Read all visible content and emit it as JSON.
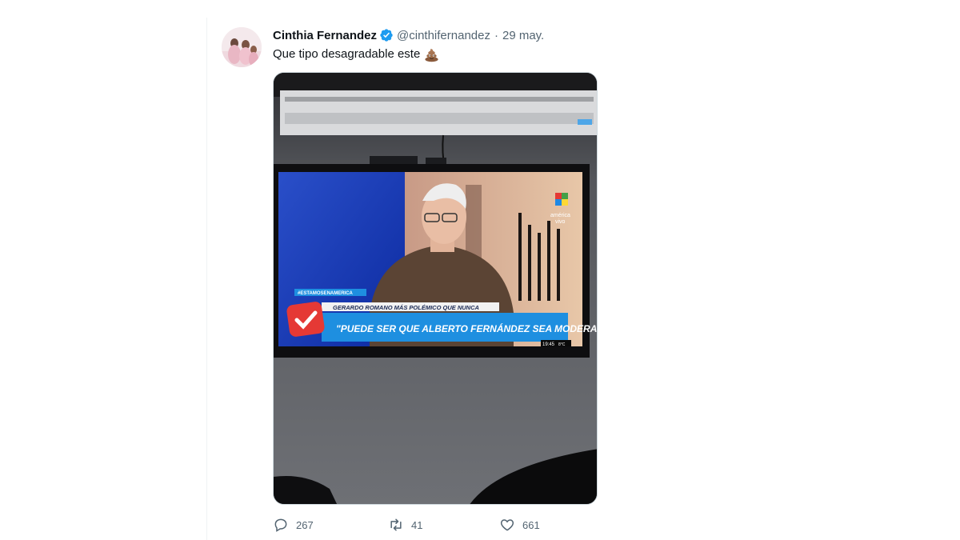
{
  "tweet": {
    "author_name": "Cinthia Fernandez",
    "handle": "@cinthifernandez",
    "separator": "·",
    "date": "29 may.",
    "text": "Que tipo desagradable este",
    "emoji": "pile-of-poo-emoji",
    "verified": true
  },
  "media": {
    "overlay": {
      "hashtag": "#ESTAMOSENAMERICA",
      "subtitle": "GERARDO ROMANO MÁS POLÉMICO QUE NUNCA",
      "headline": "\"PUEDE SER QUE ALBERTO FERNÁNDEZ SEA MODERADO\"",
      "time": "19:45",
      "temperature": "8°C",
      "channel": "américa",
      "channel_status": "vivo"
    }
  },
  "actions": {
    "replies": "267",
    "retweets": "41",
    "likes": "661"
  },
  "colors": {
    "verified_badge": "#1d9bf0",
    "muted_text": "#536471",
    "headline_bar": "#1e8fe0"
  }
}
